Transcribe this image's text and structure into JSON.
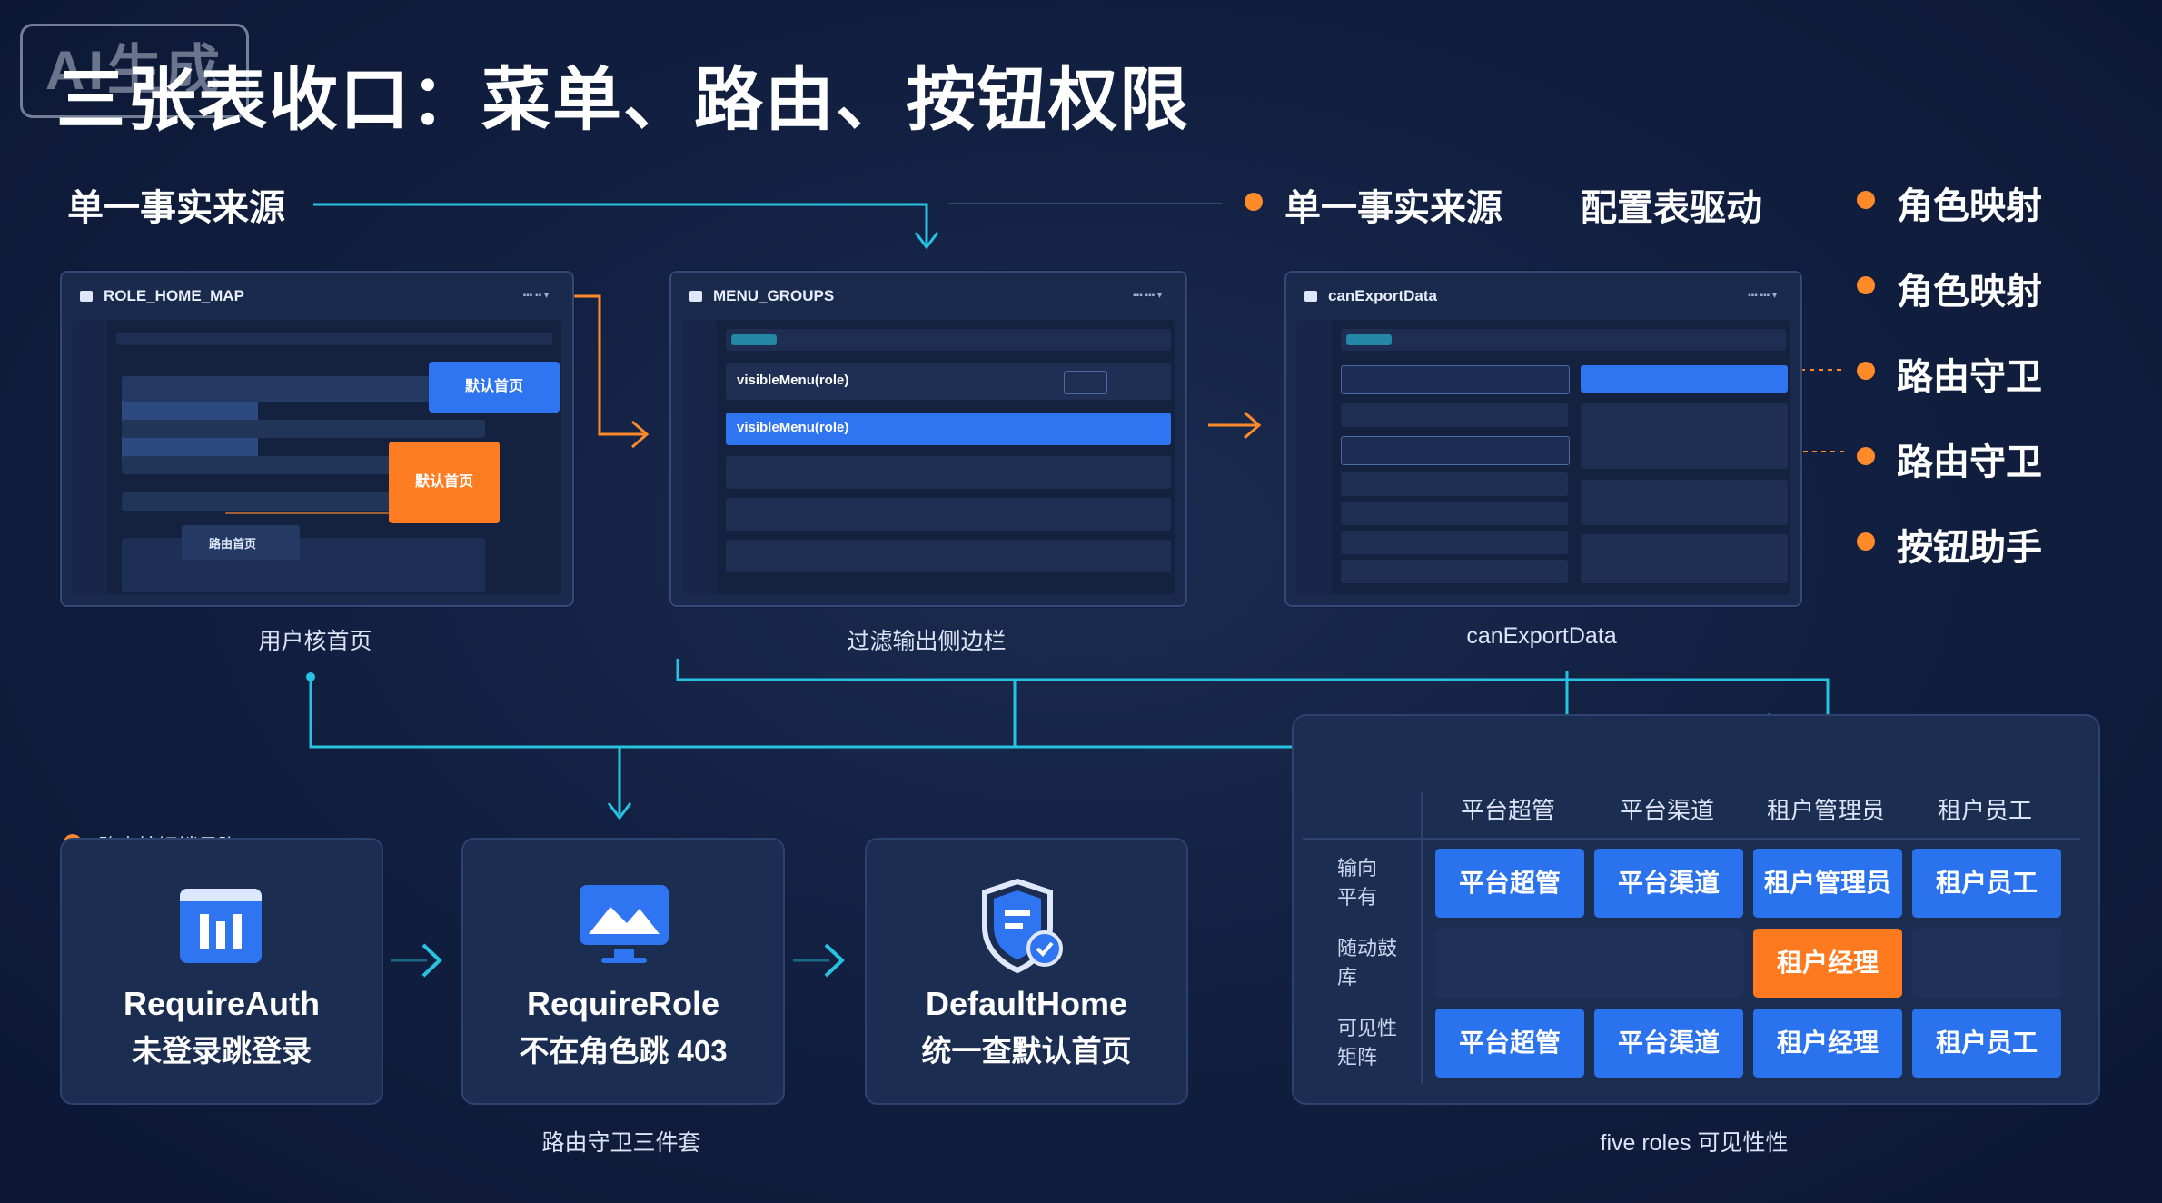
{
  "watermark": "AI生成",
  "title": "三张表收口：菜单、路由、按钮权限",
  "top_labels": {
    "left": "单一事实来源",
    "middle": "单一事实来源",
    "right": "配置表驱动"
  },
  "side_list": [
    "角色映射",
    "角色映射",
    "路由守卫",
    "路由守卫",
    "按钮助手"
  ],
  "panels": [
    {
      "header": "ROLE_HOME_MAP",
      "caption": "用户核首页",
      "buttons": [
        "默认首页",
        "默认首页"
      ],
      "small_label": "路由首页"
    },
    {
      "header": "MENU_GROUPS",
      "caption": "过滤输出侧边栏",
      "rows": [
        "visibleMenu(role)",
        "visibleMenu(role)"
      ]
    },
    {
      "header": "canExportData",
      "caption": "canExportData"
    }
  ],
  "guard_section": {
    "label": "路由按钮锁显隐",
    "caption": "路由守卫三件套",
    "cards": [
      {
        "line1": "RequireAuth",
        "line2": "未登录跳登录",
        "icon": "lock-grid-icon"
      },
      {
        "line1": "RequireRole",
        "line2": "不在角色跳 403",
        "icon": "monitor-chart-icon"
      },
      {
        "line1": "DefaultHome",
        "line2": "统一查默认首页",
        "icon": "shield-doc-icon"
      }
    ]
  },
  "matrix": {
    "caption": "five roles 可见性性",
    "columns": [
      "平台超管",
      "平台渠道",
      "租户管理员",
      "租户员工"
    ],
    "rows": [
      {
        "label": "输向 平有",
        "cells": [
          "平台超管",
          "平台渠道",
          "租户管理员",
          "租户员工"
        ]
      },
      {
        "label": "随动鼓 库",
        "cells": [
          "",
          "",
          "租户经理",
          ""
        ]
      },
      {
        "label": "可见性 矩阵",
        "cells": [
          "平台超管",
          "平台渠道",
          "租户经理",
          "租户员工"
        ]
      }
    ]
  },
  "colors": {
    "accent_cyan": "#27c3e0",
    "accent_orange": "#ff7d22",
    "primary_blue": "#2f74f0",
    "background": "#122042"
  }
}
